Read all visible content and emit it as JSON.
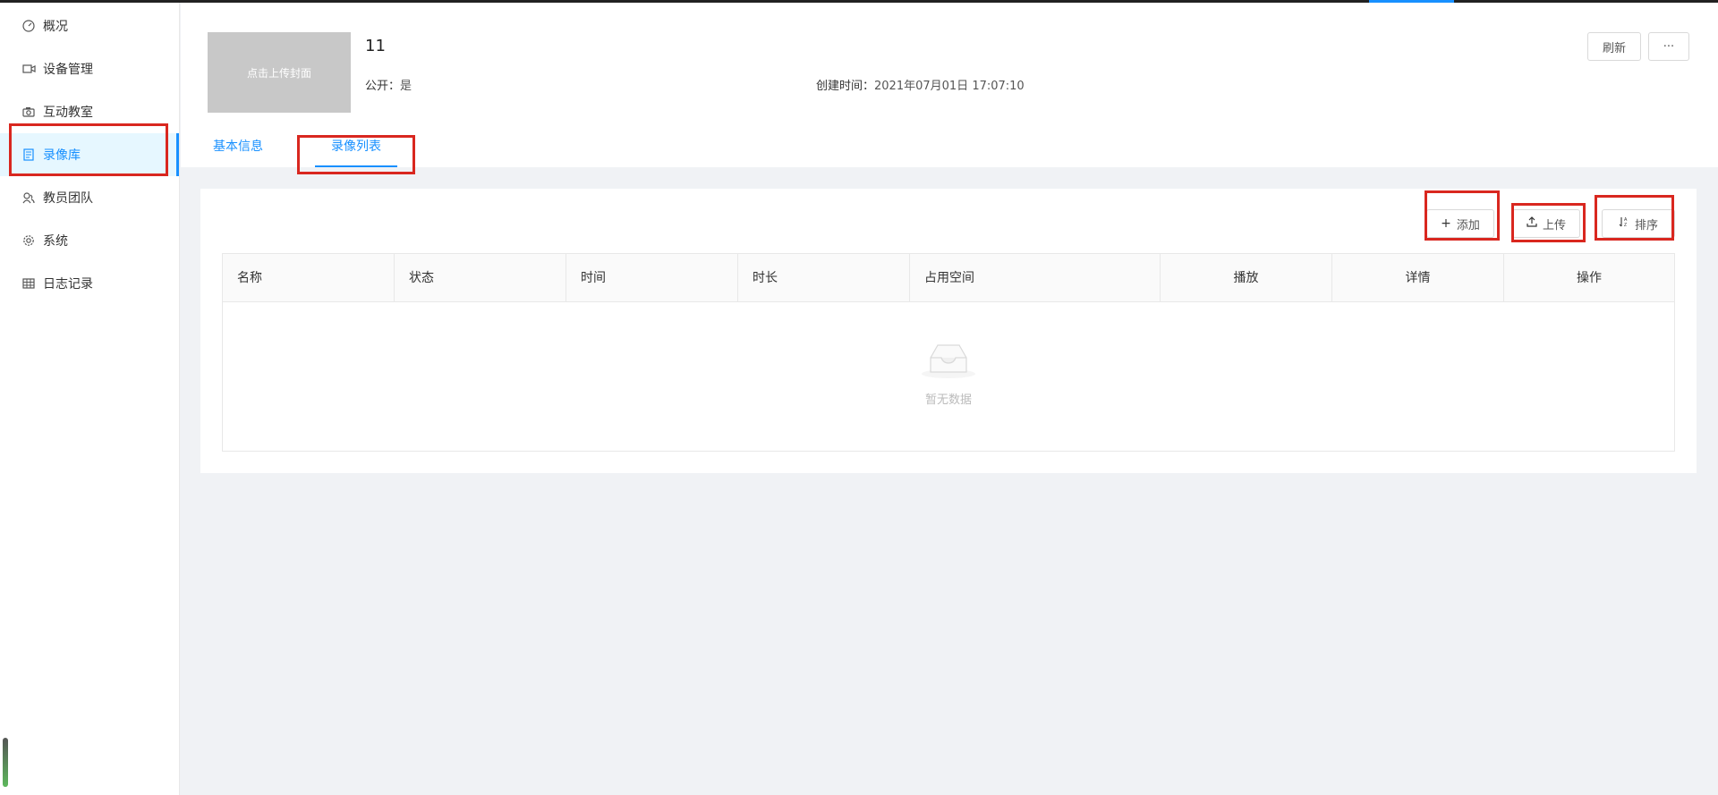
{
  "colors": {
    "accent": "#1890ff",
    "annotation": "#d9271f",
    "active_bg": "#e6f7ff"
  },
  "sidebar": {
    "items": [
      {
        "label": "概况",
        "icon": "dashboard-icon"
      },
      {
        "label": "设备管理",
        "icon": "video-device-icon"
      },
      {
        "label": "互动教室",
        "icon": "camera-icon"
      },
      {
        "label": "录像库",
        "icon": "book-icon",
        "active": true
      },
      {
        "label": "教员团队",
        "icon": "team-icon"
      },
      {
        "label": "系统",
        "icon": "gear-icon"
      },
      {
        "label": "日志记录",
        "icon": "table-icon"
      }
    ]
  },
  "header": {
    "cover_label": "点击上传封面",
    "title": "11",
    "public_label": "公开：",
    "public_value": "是",
    "created_label": "创建时间：",
    "created_value": "2021年07月01日 17:07:10",
    "refresh_label": "刷新",
    "more_label": "···",
    "tabs": [
      {
        "label": "基本信息",
        "active": false
      },
      {
        "label": "录像列表",
        "active": true
      }
    ]
  },
  "toolbar": {
    "add_label": "添加",
    "upload_label": "上传",
    "sort_label": "排序"
  },
  "table": {
    "columns": [
      "名称",
      "状态",
      "时间",
      "时长",
      "占用空间",
      "播放",
      "详情",
      "操作"
    ],
    "rows": [],
    "empty_text": "暂无数据"
  }
}
